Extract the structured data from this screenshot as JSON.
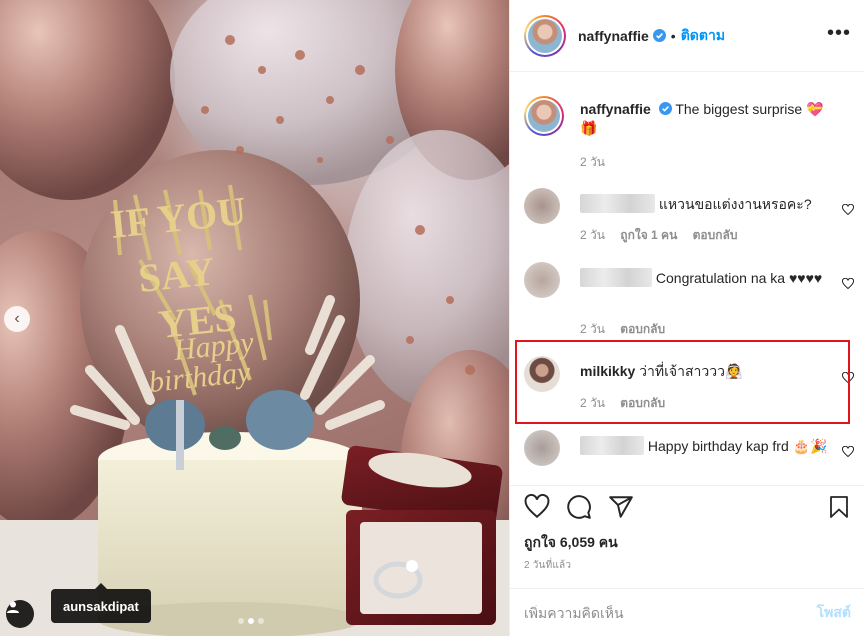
{
  "photo": {
    "tagged_user": "aunsakdipat",
    "topper_text": [
      "IF YOU",
      "SAY",
      "YES",
      "Happy",
      "birthday"
    ],
    "carousel": {
      "count": 3,
      "active": 2
    },
    "prev_icon": "chevron-left-icon"
  },
  "header": {
    "username": "naffynaffie",
    "separator": "•",
    "follow_label": "ติดตาม",
    "more_label": "•••"
  },
  "caption": {
    "username": "naffynaffie",
    "text": "The biggest surprise 💝🎁",
    "time": "2 วัน"
  },
  "comments": [
    {
      "text": "แหวนขอแต่งงานหรอคะ?",
      "time": "2 วัน",
      "likes": "ถูกใจ 1 คน",
      "reply": "ตอบกลับ"
    },
    {
      "text": "Congratulation na ka ♥♥♥♥",
      "time": "2 วัน",
      "reply": "ตอบกลับ"
    },
    {
      "username": "milkikky",
      "text": "ว่าที่เจ้าสาววว👰",
      "time": "2 วัน",
      "reply": "ตอบกลับ"
    },
    {
      "text": "Happy birthday kap frd 🎂🎉",
      "time": "",
      "reply": ""
    }
  ],
  "actions": {
    "likes": "ถูกใจ 6,059 คน",
    "time_ago": "2 วันที่แล้ว"
  },
  "add_comment": {
    "placeholder": "เพิ่มความคิดเห็น",
    "post_label": "โพสต์"
  },
  "colors": {
    "link_blue": "#0095f6",
    "post_disabled": "#b2dffc",
    "highlight_red": "#e0141c"
  }
}
